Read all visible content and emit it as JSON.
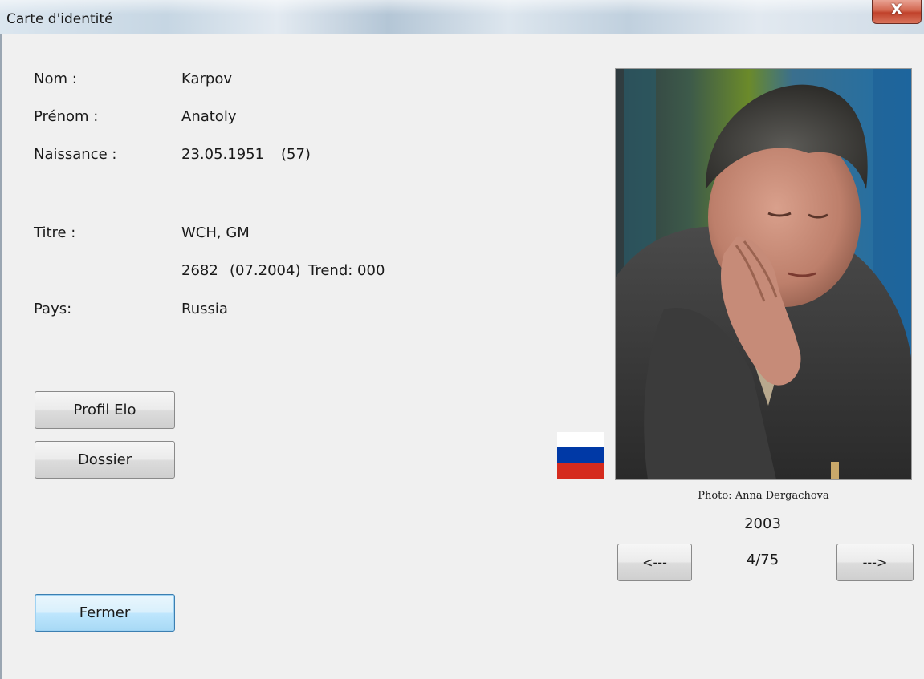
{
  "window": {
    "title": "Carte d'identité",
    "close_glyph": "X"
  },
  "fields": {
    "nom_label": "Nom :",
    "nom_value": "Karpov",
    "prenom_label": "Prénom :",
    "prenom_value": "Anatoly",
    "naissance_label": "Naissance :",
    "naissance_value": "23.05.1951",
    "age_value": "(57)",
    "titre_label": "Titre :",
    "titre_value": "WCH, GM",
    "elo_value": "2682",
    "elo_date": "(07.2004)",
    "trend_value": "Trend: 000",
    "pays_label": "Pays:",
    "pays_value": "Russia"
  },
  "buttons": {
    "profil_elo": "Profil Elo",
    "dossier": "Dossier",
    "fermer": "Fermer",
    "prev": "<---",
    "next": "--->"
  },
  "photo": {
    "caption": "Photo: Anna Dergachova",
    "year": "2003",
    "counter": "4/75"
  },
  "flag": {
    "country": "Russia",
    "stripes": [
      "#ffffff",
      "#0039a6",
      "#d52b1e"
    ]
  },
  "icons": {
    "close": "close-icon",
    "flag": "russia-flag-icon"
  }
}
